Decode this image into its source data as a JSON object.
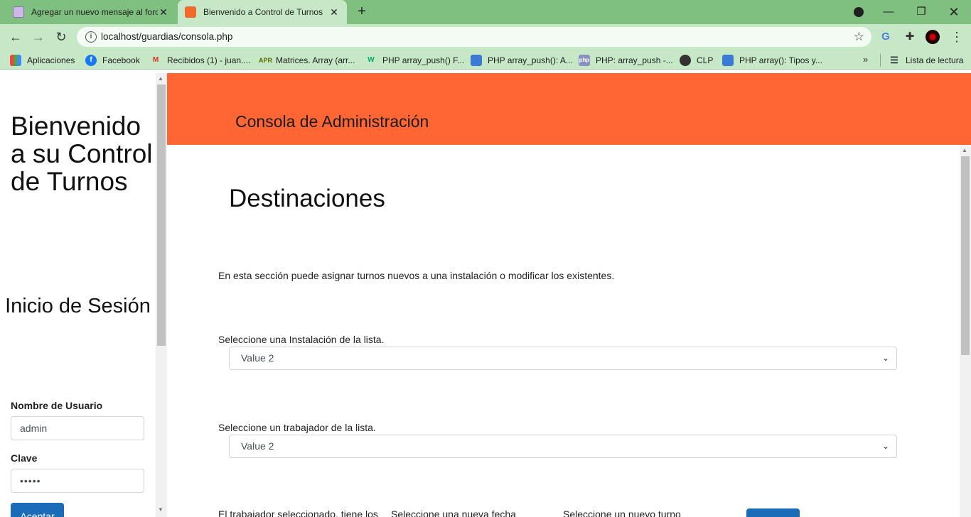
{
  "browser": {
    "tabs": [
      {
        "title": "Agregar un nuevo mensaje al foro",
        "active": false
      },
      {
        "title": "Bienvenido a Control de Turnos",
        "active": true
      }
    ],
    "url": "localhost/guardias/consola.php",
    "bookmarks": [
      {
        "label": "Aplicaciones",
        "icon": "apps-grid-icon"
      },
      {
        "label": "Facebook",
        "icon": "facebook-icon"
      },
      {
        "label": "Recibidos (1) - juan....",
        "icon": "gmail-icon"
      },
      {
        "label": "Matrices. Array (arr...",
        "icon": "apr-icon"
      },
      {
        "label": "PHP array_push() F...",
        "icon": "w3schools-icon"
      },
      {
        "label": "PHP array_push(): A...",
        "icon": "cube-icon"
      },
      {
        "label": "PHP: array_push -...",
        "icon": "php-icon"
      },
      {
        "label": "CLP",
        "icon": "globe-icon"
      },
      {
        "label": "PHP array(): Tipos y...",
        "icon": "cube-icon"
      }
    ],
    "reading_list": "Lista de lectura"
  },
  "sidebar": {
    "welcome": "Bienvenido a su Control de Turnos",
    "login_title": "Inicio de Sesión",
    "username_label": "Nombre de Usuario",
    "username_value": "admin",
    "password_label": "Clave",
    "password_value": "•••••",
    "login_button": "Aceptar"
  },
  "main": {
    "banner_title": "Consola de Administración",
    "section_title": "Destinaciones",
    "intro": "En esta sección puede asignar turnos nuevos a una instalación o modificar los existentes.",
    "installation_label": "Seleccione una Instalación de la lista.",
    "installation_value": "Value 2",
    "worker_label": "Seleccione un trabajador de la lista.",
    "worker_value": "Value 2",
    "bottom_labels": [
      "El trabajador seleccionado, tiene los",
      "Seleccione una nueva fecha",
      "Seleccione un nuevo turno"
    ]
  },
  "colors": {
    "tab_strip": "#7fbf7f",
    "toolbar": "#c6e8c6",
    "banner": "#ff6633",
    "primary_button": "#1a6bb8"
  }
}
